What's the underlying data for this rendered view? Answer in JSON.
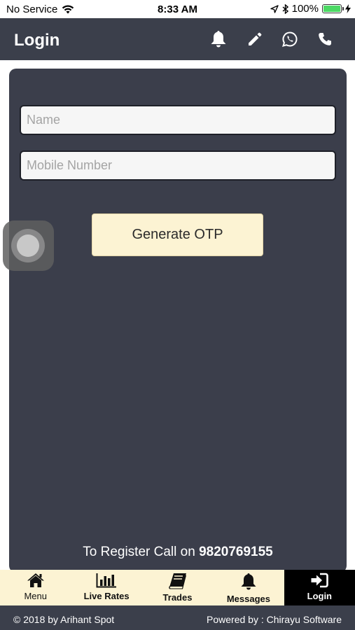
{
  "status_bar": {
    "carrier": "No Service",
    "time": "8:33 AM",
    "battery": "100%",
    "battery_level": 1.0
  },
  "header": {
    "title": "Login",
    "icons": [
      "bell-icon",
      "pencil-icon",
      "whatsapp-icon",
      "phone-icon"
    ]
  },
  "form": {
    "name_placeholder": "Name",
    "name_value": "",
    "mobile_placeholder": "Mobile Number",
    "mobile_value": "",
    "otp_button": "Generate OTP"
  },
  "register": {
    "text": "To Register Call on",
    "number": "9820769155"
  },
  "tabs": [
    {
      "label": "Menu",
      "icon": "home-icon"
    },
    {
      "label": "Live Rates",
      "icon": "bar-chart-icon"
    },
    {
      "label": "Trades",
      "icon": "book-icon"
    },
    {
      "label": "Messages",
      "icon": "bell-icon"
    },
    {
      "label": "Login",
      "icon": "sign-in-icon",
      "active": true
    }
  ],
  "footer": {
    "left": "© 2018 by Arihant Spot",
    "right": "Powered by : Chirayu Software"
  },
  "colors": {
    "header": "#3b3f4b",
    "panel": "#3b3e4b",
    "tab_bg": "#fcf3d3",
    "button_bg": "#fcf3d3",
    "battery": "#4cd964"
  }
}
